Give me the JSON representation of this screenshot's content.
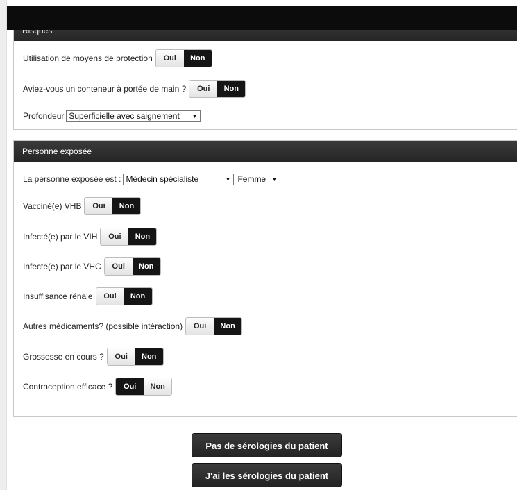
{
  "risques": {
    "title": "Risques",
    "protection": {
      "label": "Utilisation de moyens de protection",
      "yes": "Oui",
      "no": "Non"
    },
    "conteneur": {
      "label": "Aviez-vous un conteneur à portée de main ?",
      "yes": "Oui",
      "no": "Non"
    },
    "profondeur": {
      "label": "Profondeur",
      "selected": "Superficielle avec saignement"
    }
  },
  "personne": {
    "title": "Personne exposée",
    "est": {
      "label": "La personne exposée est :",
      "profession": "Médecin spécialiste",
      "sexe": "Femme"
    },
    "vhb": {
      "label": "Vacciné(e) VHB",
      "yes": "Oui",
      "no": "Non"
    },
    "vih": {
      "label": "Infecté(e) par le VIH",
      "yes": "Oui",
      "no": "Non"
    },
    "vhc": {
      "label": "Infecté(e) par le VHC",
      "yes": "Oui",
      "no": "Non"
    },
    "renale": {
      "label": "Insuffisance rénale",
      "yes": "Oui",
      "no": "Non"
    },
    "medicaments": {
      "label": "Autres médicaments? (possible intéraction)",
      "yes": "Oui",
      "no": "Non"
    },
    "grossesse": {
      "label": "Grossesse en cours ?",
      "yes": "Oui",
      "no": "Non"
    },
    "contraception": {
      "label": "Contraception efficace ?",
      "yes": "Oui",
      "no": "Non"
    }
  },
  "actions": {
    "no_serology": "Pas de sérologies du patient",
    "has_serology": "J'ai les sérologies du patient"
  }
}
